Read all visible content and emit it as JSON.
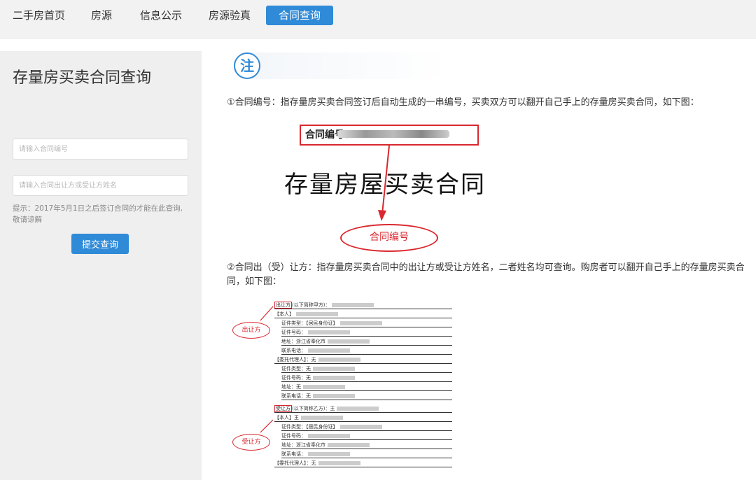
{
  "nav": {
    "items": [
      {
        "label": "二手房首页"
      },
      {
        "label": "房源"
      },
      {
        "label": "信息公示"
      },
      {
        "label": "房源验真"
      },
      {
        "label": "合同查询",
        "active": true
      }
    ]
  },
  "sidebar": {
    "title": "存量房买卖合同查询",
    "contract_no_placeholder": "请输入合同编号",
    "party_name_placeholder": "请输入合同出让方或受让方姓名",
    "tip": "提示：2017年5月1日之后签订合同的才能在此查询,敬请谅解",
    "submit_label": "提交查询"
  },
  "main": {
    "note_label": "注",
    "para1": "①合同编号：指存量房买卖合同签订后自动生成的一串编号，买卖双方可以翻开自己手上的存量房买卖合同，如下图：",
    "fig1": {
      "contract_no_label": "合同编号：",
      "big_title": "存量房屋买卖合同",
      "ellipse_label": "合同编号"
    },
    "para2": "②合同出（受）让方：指存量房买卖合同中的出让方或受让方姓名，二者姓名均可查询。购房者可以翻开自己手上的存量房买卖合同，如下图：",
    "fig2": {
      "seller_ellipse": "出让方",
      "buyer_ellipse": "受让方",
      "seller_lines": [
        {
          "box": "出让方",
          "text": "(以下简称甲方)：",
          "indent": false
        },
        {
          "box": "",
          "text": "【本人】",
          "indent": false
        },
        {
          "box": "",
          "text": "证件类型：【居民身份证】",
          "indent": true
        },
        {
          "box": "",
          "text": "证件号码：",
          "indent": true
        },
        {
          "box": "",
          "text": "地址：浙江省奉化市",
          "indent": true
        },
        {
          "box": "",
          "text": "联系电话：",
          "indent": true
        },
        {
          "box": "",
          "text": "【委托代理人】：无",
          "indent": false
        },
        {
          "box": "",
          "text": "证件类型：无",
          "indent": true
        },
        {
          "box": "",
          "text": "证件号码：无",
          "indent": true
        },
        {
          "box": "",
          "text": "地址：无",
          "indent": true
        },
        {
          "box": "",
          "text": "联系电话：无",
          "indent": true
        }
      ],
      "buyer_lines": [
        {
          "box": "受让方",
          "text": "(以下简称乙方)：王",
          "indent": false
        },
        {
          "box": "",
          "text": "【本人】王",
          "indent": false
        },
        {
          "box": "",
          "text": "证件类型：【居民身份证】",
          "indent": true
        },
        {
          "box": "",
          "text": "证件号码：",
          "indent": true
        },
        {
          "box": "",
          "text": "地址：浙江省奉化市",
          "indent": true
        },
        {
          "box": "",
          "text": "联系电话：",
          "indent": true
        },
        {
          "box": "",
          "text": "【委托代理人】：无",
          "indent": false
        }
      ]
    }
  },
  "colors": {
    "accent": "#2f8ad8",
    "highlight_red": "#d9282f"
  }
}
